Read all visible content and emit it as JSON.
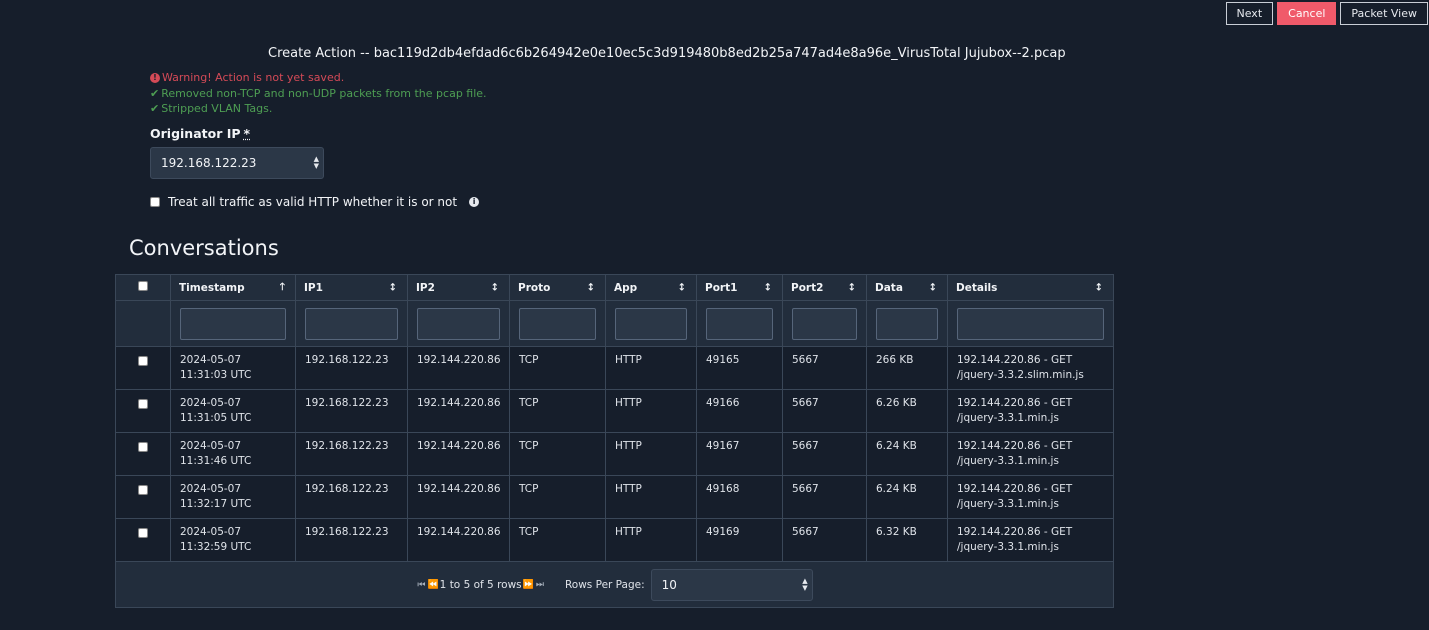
{
  "toolbar": {
    "next": "Next",
    "cancel": "Cancel",
    "packet_view": "Packet View"
  },
  "page_title": "Create Action -- bac119d2db4efdad6c6b264942e0e10ec5c3d919480b8ed2b25a747ad4e8a96e_VirusTotal Jujubox--2.pcap",
  "messages": {
    "warning": "Warning! Action is not yet saved.",
    "removed": "Removed non-TCP and non-UDP packets from the pcap file.",
    "stripped": "Stripped VLAN Tags."
  },
  "originator": {
    "label": "Originator IP",
    "required_mark": "*",
    "value": "192.168.122.23"
  },
  "http_option": {
    "label": "Treat all traffic as valid HTTP whether it is or not"
  },
  "conversations": {
    "title": "Conversations",
    "columns": [
      "Timestamp",
      "IP1",
      "IP2",
      "Proto",
      "App",
      "Port1",
      "Port2",
      "Data",
      "Details"
    ],
    "rows": [
      {
        "timestamp": "2024-05-07 11:31:03 UTC",
        "ip1": "192.168.122.23",
        "ip2": "192.144.220.86",
        "proto": "TCP",
        "app": "HTTP",
        "port1": "49165",
        "port2": "5667",
        "data": "266 KB",
        "details": "192.144.220.86 - GET /jquery-3.3.2.slim.min.js"
      },
      {
        "timestamp": "2024-05-07 11:31:05 UTC",
        "ip1": "192.168.122.23",
        "ip2": "192.144.220.86",
        "proto": "TCP",
        "app": "HTTP",
        "port1": "49166",
        "port2": "5667",
        "data": "6.26 KB",
        "details": "192.144.220.86 - GET /jquery-3.3.1.min.js"
      },
      {
        "timestamp": "2024-05-07 11:31:46 UTC",
        "ip1": "192.168.122.23",
        "ip2": "192.144.220.86",
        "proto": "TCP",
        "app": "HTTP",
        "port1": "49167",
        "port2": "5667",
        "data": "6.24 KB",
        "details": "192.144.220.86 - GET /jquery-3.3.1.min.js"
      },
      {
        "timestamp": "2024-05-07 11:32:17 UTC",
        "ip1": "192.168.122.23",
        "ip2": "192.144.220.86",
        "proto": "TCP",
        "app": "HTTP",
        "port1": "49168",
        "port2": "5667",
        "data": "6.24 KB",
        "details": "192.144.220.86 - GET /jquery-3.3.1.min.js"
      },
      {
        "timestamp": "2024-05-07 11:32:59 UTC",
        "ip1": "192.168.122.23",
        "ip2": "192.144.220.86",
        "proto": "TCP",
        "app": "HTTP",
        "port1": "49169",
        "port2": "5667",
        "data": "6.32 KB",
        "details": "192.144.220.86 - GET /jquery-3.3.1.min.js"
      }
    ],
    "pagination": {
      "range_text": "1 to 5 of 5 rows",
      "rows_per_page_label": "Rows Per Page:",
      "rows_per_page_value": "10"
    }
  },
  "colors": {
    "background": "#161e2b",
    "cancel": "#f05a6a",
    "warning": "#d44a57",
    "success": "#4e9e53"
  }
}
